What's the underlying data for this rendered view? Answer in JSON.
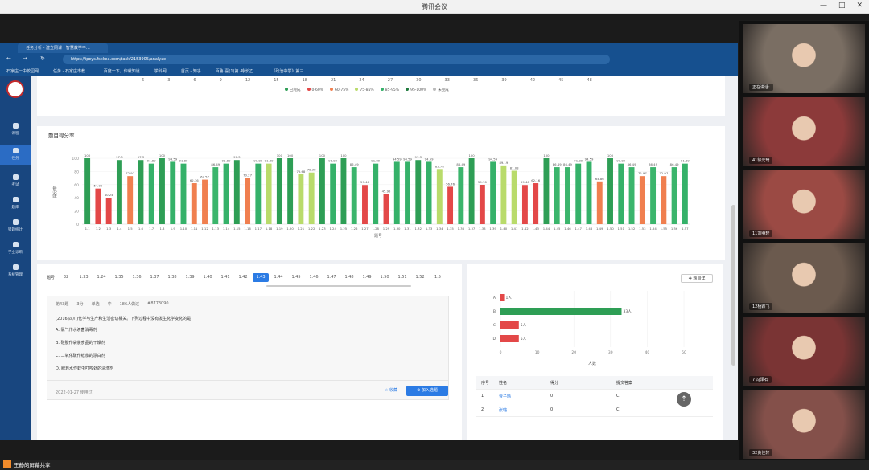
{
  "meeting": {
    "title": "腾讯会议",
    "win": [
      "—",
      "□",
      "✕"
    ]
  },
  "browser": {
    "tab": "任务分析 - 建立同课 | 智慧教学平…",
    "url": "https://ipcys.fsxkea.com/task/2153905/analyze",
    "bookmarks": [
      "石家庄一中校园网",
      "任务 - 石家庄市教...",
      "百度一下，你就知道",
      "学科网",
      "首页 - 知乎",
      "百鲁 喜(1)第 ·咏长乙...",
      "《政治中学》第三..."
    ]
  },
  "sidebar": [
    "课程",
    "任务",
    "考试",
    "题库",
    "错题统计",
    "学业诊断",
    "系统管理"
  ],
  "top_ticks": [
    "6",
    "3",
    "6",
    "9",
    "12",
    "15",
    "18",
    "21",
    "24",
    "27",
    "30",
    "33",
    "36",
    "39",
    "42",
    "45",
    "48"
  ],
  "legend": [
    "已完成",
    "0-60%",
    "60-75%",
    "75-85%",
    "85-95%",
    "95-100%",
    "未完成"
  ],
  "chart_title": "题目得分率",
  "chart_data": {
    "type": "bar",
    "title": "题目得分率",
    "xlabel": "题号",
    "ylabel": "得分率",
    "ylim": [
      0,
      100
    ],
    "categories": [
      "1.1",
      "1.2",
      "1.3",
      "1.4",
      "1.5",
      "1.6",
      "1.7",
      "1.8",
      "1.9",
      "1.10",
      "1.11",
      "1.12",
      "1.13",
      "1.14",
      "1.15",
      "1.16",
      "1.17",
      "1.18",
      "1.19",
      "1.20",
      "1.21",
      "1.22",
      "1.23",
      "1.24",
      "1.25",
      "1.26",
      "1.27",
      "1.28",
      "1.29",
      "1.30",
      "1.31",
      "1.32",
      "1.33",
      "1.34",
      "1.35",
      "1.36",
      "1.37",
      "1.38",
      "1.39",
      "1.40",
      "1.41",
      "1.42",
      "1.43",
      "1.44",
      "1.45",
      "1.46",
      "1.47",
      "1.48",
      "1.49",
      "1.50",
      "1.51",
      "1.52",
      "1.53",
      "1.54",
      "1.55",
      "1.56",
      "1.57"
    ],
    "values": [
      100,
      54.05,
      40.24,
      97.3,
      72.97,
      97.3,
      91.89,
      100,
      94.59,
      91.89,
      62.16,
      67.57,
      86.49,
      91.89,
      97.3,
      70.27,
      91.89,
      91.89,
      100,
      100,
      75.68,
      78.38,
      100,
      91.89,
      100,
      86.49,
      59.46,
      91.89,
      45.95,
      94.59,
      94.59,
      97.3,
      94.59,
      83.78,
      56.76,
      86.49,
      100,
      59.76,
      94.59,
      89.19,
      81.08,
      59.46,
      62.16,
      100,
      86.49,
      86.49,
      91.89,
      94.59,
      64.86,
      100,
      91.89,
      86.49,
      72.97,
      86.49,
      72.97,
      86.49,
      91.89
    ],
    "colors": [
      "#2e9e55",
      "#e34848",
      "#e34848",
      "#2e9e55",
      "#f07f4f",
      "#2e9e55",
      "#35b169",
      "#2e9e55",
      "#35b169",
      "#35b169",
      "#f07f4f",
      "#f07f4f",
      "#3bb56c",
      "#35b169",
      "#2e9e55",
      "#f07f4f",
      "#35b169",
      "#b9db6b",
      "#2e9e55",
      "#2e9e55",
      "#b9db6b",
      "#b9db6b",
      "#2e9e55",
      "#35b169",
      "#2e9e55",
      "#3bb56c",
      "#e34848",
      "#35b169",
      "#e34848",
      "#35b169",
      "#35b169",
      "#2e9e55",
      "#35b169",
      "#b9db6b",
      "#e34848",
      "#3bb56c",
      "#2e9e55",
      "#e34848",
      "#35b169",
      "#b9db6b",
      "#b9db6b",
      "#e34848",
      "#e34848",
      "#2e9e55",
      "#3bb56c",
      "#3bb56c",
      "#35b169",
      "#35b169",
      "#f07f4f",
      "#2e9e55",
      "#35b169",
      "#3bb56c",
      "#f07f4f",
      "#3bb56c",
      "#f07f4f",
      "#3bb56c",
      "#35b169"
    ]
  },
  "qnav": {
    "label": "题号",
    "items": [
      "32",
      "1.33",
      "1.24",
      "1.35",
      "1.36",
      "1.37",
      "1.38",
      "1.39",
      "1.40",
      "1.41",
      "1.42",
      "1.43",
      "1.44",
      "1.45",
      "1.46",
      "1.47",
      "1.48",
      "1.49",
      "1.50",
      "1.51",
      "1.52",
      "1.5"
    ],
    "active": "1.43"
  },
  "question": {
    "meta": [
      "第43题",
      "3分",
      "单选",
      "中",
      "186人做过",
      "#8773090"
    ],
    "stem": "(2016·四川)化学与生产和生活密切相关。下列过程中没有发生化学变化的是",
    "options": [
      "A. 氯气作水杀菌消毒剂",
      "B. 硅胶作袋装食品的干燥剂",
      "C. 二氧化硫作纸浆的漂白剂",
      "D. 肥皂水作蚊虫叮咬处的清洗剂"
    ],
    "date": "2022-01-27  使用过",
    "collect": "☆ 收藏",
    "add": "⊕ 加入选题"
  },
  "answer_chart": {
    "labels": [
      "A",
      "B",
      "C",
      "D"
    ],
    "values": [
      1,
      33,
      5,
      5
    ],
    "value_labels": [
      "1人",
      "33人",
      "5人",
      "5人"
    ],
    "xticks": [
      "0",
      "10",
      "20",
      "30",
      "40",
      "50"
    ],
    "xlabel": "人数",
    "max": 50
  },
  "detail_btn": "✚ 题目详",
  "table": {
    "headers": [
      "序号",
      "姓名",
      "得分",
      "提交答案"
    ],
    "rows": [
      [
        "1",
        "曹子晴",
        "0",
        "C"
      ],
      [
        "2",
        "张璐",
        "0",
        "C"
      ]
    ]
  },
  "participants": [
    {
      "name": "正在讲话:",
      "bg": "#7a6e63"
    },
    {
      "name": "41徐元琦",
      "bg": "#8c3a3a"
    },
    {
      "name": "11刘明轩",
      "bg": "#9b4a44"
    },
    {
      "name": "12杨霖飞",
      "bg": "#6b5a4e"
    },
    {
      "name": "7 冯泽石",
      "bg": "#7a3434"
    },
    {
      "name": "32黄佳轩",
      "bg": "#84504a"
    }
  ],
  "share": "王静的屏幕共享"
}
